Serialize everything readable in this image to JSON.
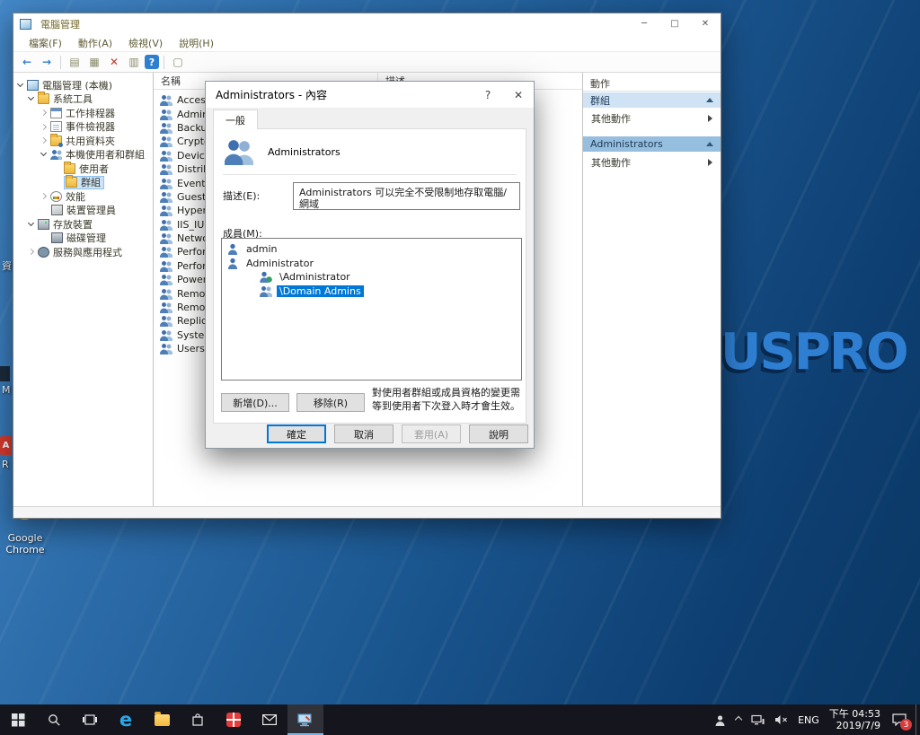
{
  "desktop": {
    "brand_text": "USPRO",
    "icon_labels": {
      "recycle": "資",
      "m": "M",
      "a": "A",
      "r": "R",
      "chrome": "Google Chrome"
    }
  },
  "window": {
    "title": "電腦管理",
    "controls": {
      "minimize": "─",
      "maximize": "□",
      "close": "✕"
    },
    "menu": [
      {
        "label": "檔案(F)"
      },
      {
        "label": "動作(A)"
      },
      {
        "label": "檢視(V)"
      },
      {
        "label": "說明(H)"
      }
    ],
    "toolbar": [
      {
        "glyph": "←"
      },
      {
        "glyph": "→"
      },
      {
        "glyph": "▤"
      },
      {
        "glyph": "▦"
      },
      {
        "glyph": "✕"
      },
      {
        "glyph": "▥"
      },
      {
        "glyph": "?"
      },
      {
        "glyph": "▢"
      }
    ],
    "tree": [
      {
        "label": "電腦管理 (本機)"
      },
      {
        "label": "系統工具"
      },
      {
        "label": "工作排程器"
      },
      {
        "label": "事件檢視器"
      },
      {
        "label": "共用資料夾"
      },
      {
        "label": "本機使用者和群組"
      },
      {
        "label": "使用者"
      },
      {
        "label": "群組"
      },
      {
        "label": "效能"
      },
      {
        "label": "裝置管理員"
      },
      {
        "label": "存放裝置"
      },
      {
        "label": "磁碟管理"
      },
      {
        "label": "服務與應用程式"
      }
    ],
    "list": {
      "name_header": "名稱",
      "desc_header": "描述",
      "items": [
        {
          "name": "Access Control Assistance Operators"
        },
        {
          "name": "Administrators"
        },
        {
          "name": "Backup Operators"
        },
        {
          "name": "Cryptographic Operators"
        },
        {
          "name": "Device Owners"
        },
        {
          "name": "Distributed COM Users"
        },
        {
          "name": "Event Log Readers"
        },
        {
          "name": "Guests"
        },
        {
          "name": "Hyper-V Administrators"
        },
        {
          "name": "IIS_IUSRS"
        },
        {
          "name": "Network Configuration Operators"
        },
        {
          "name": "Performance Log Users"
        },
        {
          "name": "Performance Monitor Users"
        },
        {
          "name": "Power Users"
        },
        {
          "name": "Remote Desktop Users"
        },
        {
          "name": "Remote Management Users"
        },
        {
          "name": "Replicator"
        },
        {
          "name": "System Managed Accounts Group"
        },
        {
          "name": "Users"
        }
      ]
    },
    "actions": {
      "title": "動作",
      "group_header": "群組",
      "group_more": "其他動作",
      "admin_header": "Administrators",
      "admin_more": "其他動作"
    }
  },
  "dialog": {
    "title": "Administrators - 內容",
    "help_glyph": "?",
    "close_glyph": "✕",
    "tab_general": "一般",
    "group_name": "Administrators",
    "description_label": "描述(E):",
    "description_value": "Administrators 可以完全不受限制地存取電腦/網域",
    "members_label": "成員(M):",
    "members": [
      {
        "name": "admin"
      },
      {
        "name": "Administrator"
      },
      {
        "name": "\\Administrator"
      },
      {
        "name": "\\Domain Admins"
      }
    ],
    "note": "對使用者群組或成員資格的變更需等到使用者下次登入時才會生效。",
    "add_button": "新增(D)...",
    "remove_button": "移除(R)",
    "ok_button": "確定",
    "cancel_button": "取消",
    "apply_button": "套用(A)",
    "help_button": "說明"
  },
  "taskbar": {
    "edge_glyph": "e",
    "lang": "ENG",
    "time": "下午 04:53",
    "date": "2019/7/9",
    "notification_count": "3"
  }
}
